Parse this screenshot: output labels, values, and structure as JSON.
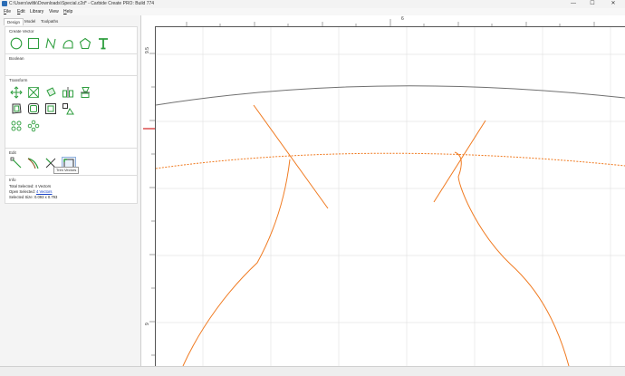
{
  "window": {
    "title": "C:\\Users\\wiltk\\Downloads\\Special.c2d* - Carbide Create PRO: Build 774",
    "minimize_glyph": "—",
    "maximize_glyph": "☐",
    "close_glyph": "✕"
  },
  "menu": {
    "file": {
      "key": "F",
      "rest": "ile"
    },
    "edit": {
      "key": "E",
      "rest": "dit"
    },
    "library": "Library",
    "view": "View",
    "help": {
      "key": "H",
      "rest": "elp"
    }
  },
  "tabs": [
    "Design",
    "Model",
    "Toolpaths"
  ],
  "sections": {
    "create_vector": "Create Vector",
    "boolean": "Boolean",
    "transform": "Transform",
    "edit": "Edit",
    "info": "Info"
  },
  "tooltip": "Trim Vectors",
  "info": {
    "total_selected_label": "Total Selected:",
    "total_selected_value": "4 Vectors",
    "open_selected_label": "Open Selected:",
    "open_selected_value": "4 Vectors",
    "selected_size_label": "Selected Size:",
    "selected_size_value": "0.093 x 0.793"
  },
  "rulers": {
    "h_label": "6",
    "v_label_top": "9.5",
    "v_label_bottom": "9"
  },
  "colors": {
    "vector_orange": "#f07a20",
    "outline_grey": "#707070",
    "tool_green": "#2e9e3e",
    "grid": "#e4e4e4",
    "origin_marker": "#d22020"
  },
  "icons": {
    "create_vector": [
      "circle-icon",
      "rectangle-icon",
      "polyline-icon",
      "curve-icon",
      "polygon-icon",
      "text-icon"
    ],
    "transform_row1": [
      "move-icon",
      "scale-icon",
      "rotate-icon",
      "mirror-icon",
      "align-icon"
    ],
    "transform_row2": [
      "offset-icon",
      "rounded-rectangle-icon",
      "inner-offset-icon",
      "node-transform-icon"
    ],
    "transform_row3": [
      "array-icon",
      "circular-array-icon"
    ],
    "edit": [
      "node-edit-icon",
      "join-icon",
      "trim-icon",
      "trim-vectors-icon"
    ]
  }
}
